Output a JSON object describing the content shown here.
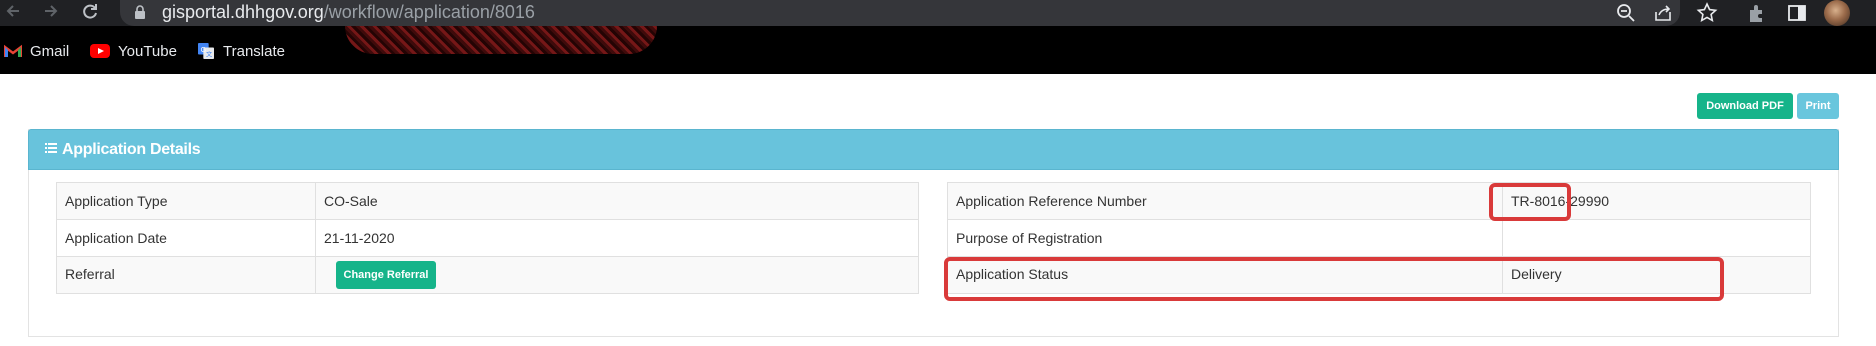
{
  "browser": {
    "url_host": "gisportal.dhhgov.org",
    "url_path": "/workflow/application/8016",
    "bookmarks": [
      {
        "label": "Gmail",
        "icon": "gmail-icon"
      },
      {
        "label": "YouTube",
        "icon": "youtube-icon"
      },
      {
        "label": "Translate",
        "icon": "translate-icon"
      }
    ]
  },
  "actions": {
    "download_pdf": "Download PDF",
    "print": "Print"
  },
  "panel": {
    "title": "Application Details",
    "left_rows": [
      {
        "key": "Application Type",
        "value": "CO-Sale"
      },
      {
        "key": "Application Date",
        "value": "21-11-2020"
      },
      {
        "key": "Referral",
        "button": "Change Referral"
      }
    ],
    "right_rows": [
      {
        "key": "Application Reference Number",
        "value": "TR-8016-29990"
      },
      {
        "key": "Purpose of Registration",
        "value": ""
      },
      {
        "key": "Application Status",
        "value": "Delivery"
      }
    ]
  },
  "colors": {
    "panel_header": "#68c3dc",
    "primary_button": "#16b48a",
    "info_button": "#69c6dd",
    "highlight": "#d93a3a"
  }
}
